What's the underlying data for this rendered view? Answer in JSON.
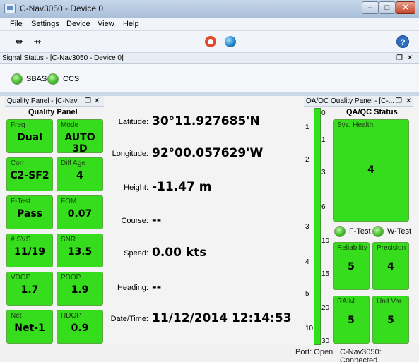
{
  "window": {
    "title": "C-Nav3050 - Device 0",
    "min": "–",
    "max": "□",
    "close": "✕"
  },
  "menu": [
    "File",
    "Settings",
    "Device",
    "View",
    "Help"
  ],
  "toolbar": {
    "help": "?"
  },
  "signal_panel": {
    "title": "Signal Status - [C-Nav3050 - Device 0]",
    "indicators": [
      {
        "label": "SBAS",
        "color": "#3dbb26"
      },
      {
        "label": "CCS",
        "color": "#3dbb26"
      }
    ]
  },
  "quality_panel": {
    "header": "Quality Panel - [C-Nav",
    "title": "Quality Panel",
    "tiles": [
      {
        "label": "Freq",
        "value": "Dual"
      },
      {
        "label": "Mode",
        "value": "AUTO 3D"
      },
      {
        "label": "Corr",
        "value": "C2-SF2"
      },
      {
        "label": "Diff Age",
        "value": "4"
      },
      {
        "label": "F-Test",
        "value": "Pass"
      },
      {
        "label": "FOM",
        "value": "0.07"
      },
      {
        "label": "# SVS",
        "value": "11/19"
      },
      {
        "label": "SNR",
        "value": "13.5"
      },
      {
        "label": "VDOP",
        "value": "1.7"
      },
      {
        "label": "PDOP",
        "value": "1.9"
      },
      {
        "label": "Net",
        "value": "Net-1"
      },
      {
        "label": "HDOP",
        "value": "0.9"
      }
    ],
    "tile_color": "#36dd1d"
  },
  "position": {
    "fields": [
      {
        "label": "Latitude:",
        "value": "30°11.927685'N"
      },
      {
        "label": "Longitude:",
        "value": "92°00.057629'W"
      },
      {
        "label": "Height:",
        "value": "-11.47 m"
      },
      {
        "label": "Course:",
        "value": "--"
      },
      {
        "label": "Speed:",
        "value": "0.00 kts"
      },
      {
        "label": "Heading:",
        "value": "--"
      },
      {
        "label": "Date/Time:",
        "value": "11/12/2014 12:14:53"
      }
    ]
  },
  "scale": {
    "left_ticks": [
      "1",
      "2",
      "3",
      "4",
      "5",
      "10"
    ],
    "right_ticks": [
      "0",
      "1",
      "3",
      "6",
      "10",
      "15",
      "20",
      "30"
    ]
  },
  "qaqc_panel": {
    "header": "QA/QC Quality Panel - [C-...",
    "title": "QA/QC Status",
    "sys_health": {
      "label": "Sys. Health",
      "value": "4"
    },
    "leds": [
      {
        "label": "F-Test"
      },
      {
        "label": "W-Test"
      }
    ],
    "tiles": [
      {
        "label": "Reliability",
        "value": "5"
      },
      {
        "label": "Precision",
        "value": "4"
      },
      {
        "label": "RAIM",
        "value": "5"
      },
      {
        "label": "Unit Var.",
        "value": "5"
      }
    ]
  },
  "status": {
    "port": "Port: Open",
    "connection": "C-Nav3050: Connected"
  }
}
